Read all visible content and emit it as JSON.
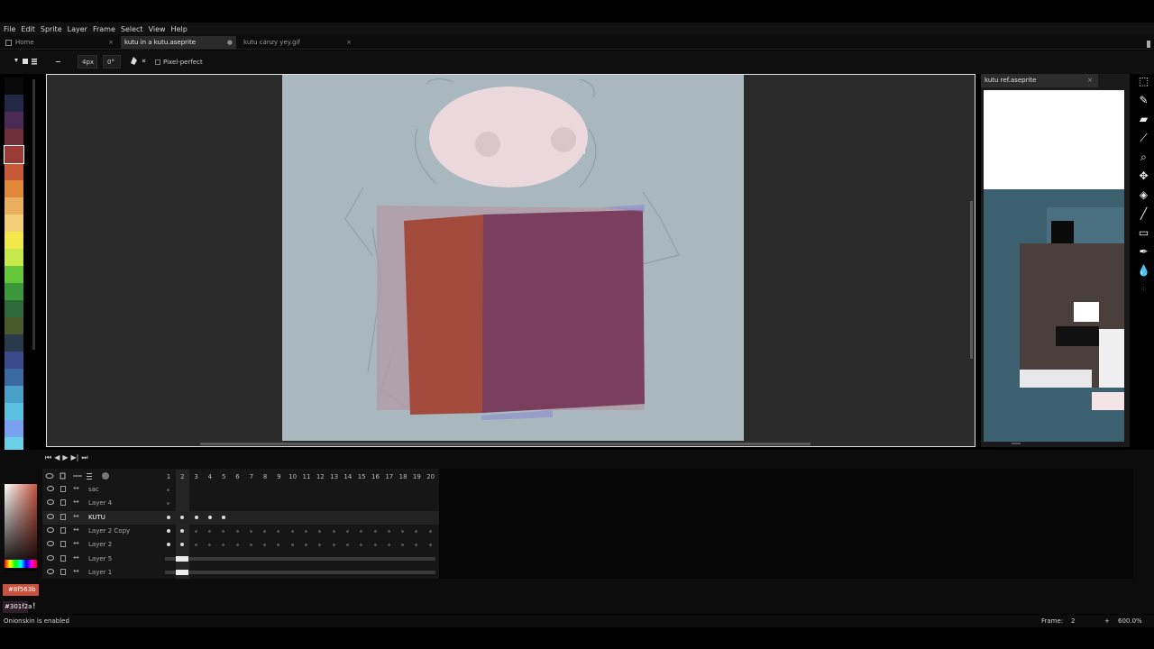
{
  "menu": [
    "File",
    "Edit",
    "Sprite",
    "Layer",
    "Frame",
    "Select",
    "View",
    "Help"
  ],
  "tabs": [
    {
      "label": "Home",
      "close": "×"
    },
    {
      "label": "kutu in a kutu.aseprite",
      "close": "●"
    },
    {
      "label": "kutu canzy yey.gif",
      "close": "×"
    }
  ],
  "toolbar": {
    "brush_size": "4px",
    "angle": "0°",
    "pixel_perfect_label": "Pixel-perfect"
  },
  "palette": [
    "#0a0a0a",
    "#232846",
    "#4a2a55",
    "#6e2f3a",
    "#9a3b35",
    "#c85a3a",
    "#e0873a",
    "#e9b060",
    "#f4cf7a",
    "#f3e84a",
    "#c8e84a",
    "#64c83a",
    "#3c963a",
    "#2c6a3a",
    "#4a5a2a",
    "#2a3a4a",
    "#3a4a8a",
    "#3a6aa0",
    "#4aa0c8",
    "#5ac0e0",
    "#7aa0f0",
    "#6ad0e8",
    "#b0d8f0",
    "#e8f0f8",
    "#ffffff",
    "#c0c8d0"
  ],
  "reference": {
    "title": "kutu ref.aseprite",
    "close": "×"
  },
  "timeline": {
    "frames": [
      "1",
      "2",
      "3",
      "4",
      "5",
      "6",
      "7",
      "8",
      "9",
      "10",
      "11",
      "12",
      "13",
      "14",
      "15",
      "16",
      "17",
      "18",
      "19",
      "20"
    ],
    "layers": [
      "sac",
      "Layer 4",
      "KUTU",
      "Layer 2 Copy",
      "Layer 2",
      "Layer 5",
      "Layer 1"
    ]
  },
  "colors": {
    "fg_label": "#8f563b",
    "fg": "#c8533f",
    "bg_label": "#301f2a",
    "bg": "#301f2a",
    "accent_red": "#a24a3c",
    "accent_purple": "#7a3f5e",
    "sprite_bg": "#a9b8bf"
  },
  "status": {
    "message": "Onionskin is enabled",
    "frame_label": "Frame:",
    "frame_value": "2",
    "zoom": "600.0%"
  }
}
